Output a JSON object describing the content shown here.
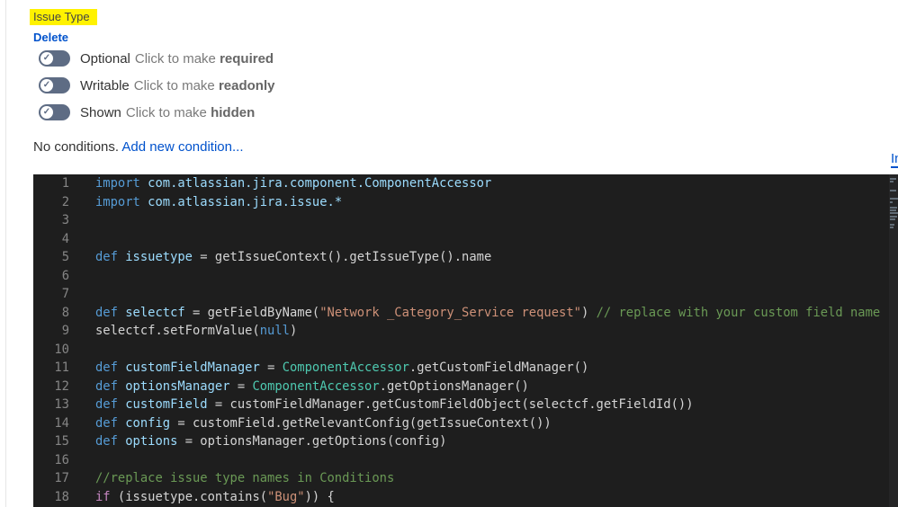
{
  "field": {
    "title": "Issue Type",
    "delete_label": "Delete"
  },
  "toggles": [
    {
      "state": "Optional",
      "hint": "Click to make",
      "action": "required"
    },
    {
      "state": "Writable",
      "hint": "Click to make",
      "action": "readonly"
    },
    {
      "state": "Shown",
      "hint": "Click to make",
      "action": "hidden"
    }
  ],
  "conditions": {
    "text": "No conditions.",
    "link": "Add new condition..."
  },
  "side_tab": "In",
  "colors": {
    "accent": "#0052cc",
    "highlight": "#fff200",
    "editor_bg": "#1e1e1e"
  },
  "code_lines": [
    [
      [
        "kw",
        "import "
      ],
      [
        "pk",
        "com.atlassian.jira.component.ComponentAccessor"
      ]
    ],
    [
      [
        "kw",
        "import "
      ],
      [
        "pk",
        "com.atlassian.jira.issue.*"
      ]
    ],
    [],
    [],
    [
      [
        "kw",
        "def "
      ],
      [
        "var",
        "issuetype"
      ],
      [
        "tx",
        " = getIssueContext().getIssueType().name"
      ]
    ],
    [],
    [],
    [
      [
        "kw",
        "def "
      ],
      [
        "var",
        "selectcf"
      ],
      [
        "tx",
        " = getFieldByName("
      ],
      [
        "str",
        "\"Network _Category_Service request\""
      ],
      [
        "tx",
        ") "
      ],
      [
        "cm",
        "// replace with your custom field name"
      ]
    ],
    [
      [
        "tx",
        "selectcf.setFormValue("
      ],
      [
        "kw",
        "null"
      ],
      [
        "tx",
        ")"
      ]
    ],
    [],
    [
      [
        "kw",
        "def "
      ],
      [
        "var",
        "customFieldManager"
      ],
      [
        "tx",
        " = "
      ],
      [
        "cls",
        "ComponentAccessor"
      ],
      [
        "tx",
        ".getCustomFieldManager()"
      ]
    ],
    [
      [
        "kw",
        "def "
      ],
      [
        "var",
        "optionsManager"
      ],
      [
        "tx",
        " = "
      ],
      [
        "cls",
        "ComponentAccessor"
      ],
      [
        "tx",
        ".getOptionsManager()"
      ]
    ],
    [
      [
        "kw",
        "def "
      ],
      [
        "var",
        "customField"
      ],
      [
        "tx",
        " = customFieldManager.getCustomFieldObject(selectcf.getFieldId())"
      ]
    ],
    [
      [
        "kw",
        "def "
      ],
      [
        "var",
        "config"
      ],
      [
        "tx",
        " = customField.getRelevantConfig(getIssueContext())"
      ]
    ],
    [
      [
        "kw",
        "def "
      ],
      [
        "var",
        "options"
      ],
      [
        "tx",
        " = optionsManager.getOptions(config)"
      ]
    ],
    [],
    [
      [
        "cm",
        "//replace issue type names in Conditions"
      ]
    ],
    [
      [
        "ctl",
        "if"
      ],
      [
        "tx",
        " (issuetype.contains("
      ],
      [
        "str",
        "\"Bug\""
      ],
      [
        "tx",
        ")) {"
      ]
    ]
  ]
}
